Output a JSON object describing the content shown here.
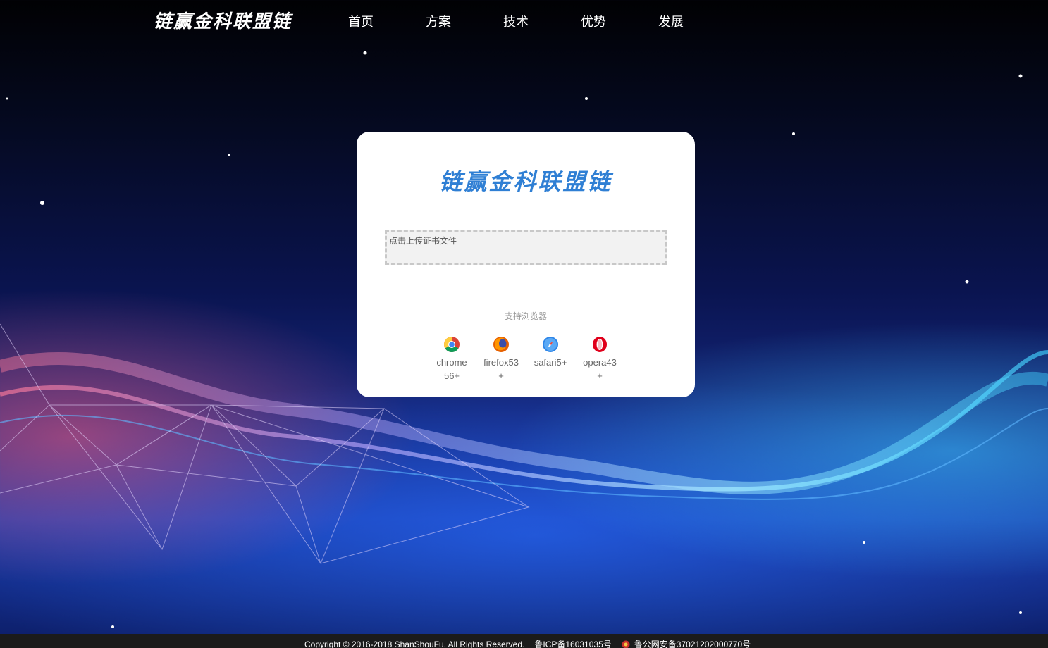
{
  "header": {
    "logo": "链赢金科联盟链",
    "nav": [
      {
        "label": "首页"
      },
      {
        "label": "方案"
      },
      {
        "label": "技术"
      },
      {
        "label": "优势"
      },
      {
        "label": "发展"
      }
    ]
  },
  "login_card": {
    "title": "链赢金科联盟链",
    "upload_text": "点击上传证书文件",
    "supported_label": "支持浏览器",
    "browsers": [
      {
        "icon": "chrome-icon",
        "label": "chrome 56+"
      },
      {
        "icon": "firefox-icon",
        "label": "firefox53 +"
      },
      {
        "icon": "safari-icon",
        "label": "safari5+"
      },
      {
        "icon": "opera-icon",
        "label": "opera43 +"
      }
    ]
  },
  "footer": {
    "copyright": "Copyright © 2016-2018 ShanShouFu. All Rights Reserved.",
    "icp": "鲁ICP备16031035号",
    "police": "鲁公网安备37021202000770号"
  },
  "colors": {
    "brand": "#2f7fd4",
    "footer_bg": "#1b1b1b",
    "card_bg": "#ffffff"
  }
}
